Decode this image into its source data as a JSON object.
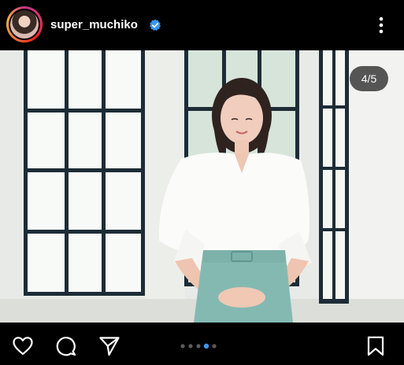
{
  "post": {
    "username": "super_muchiko",
    "verified": true,
    "carousel_counter": "4/5",
    "carousel_current": 4,
    "carousel_total": 5
  },
  "icons": {
    "verified": "verified-badge-icon",
    "more": "more-options-icon",
    "like": "heart-icon",
    "comment": "comment-icon",
    "share": "send-icon",
    "save": "bookmark-icon"
  },
  "colors": {
    "verified_badge": "#3897f0",
    "active_dot": "#3897f0",
    "inactive_dot": "#5a5a5a",
    "background": "#000000"
  }
}
